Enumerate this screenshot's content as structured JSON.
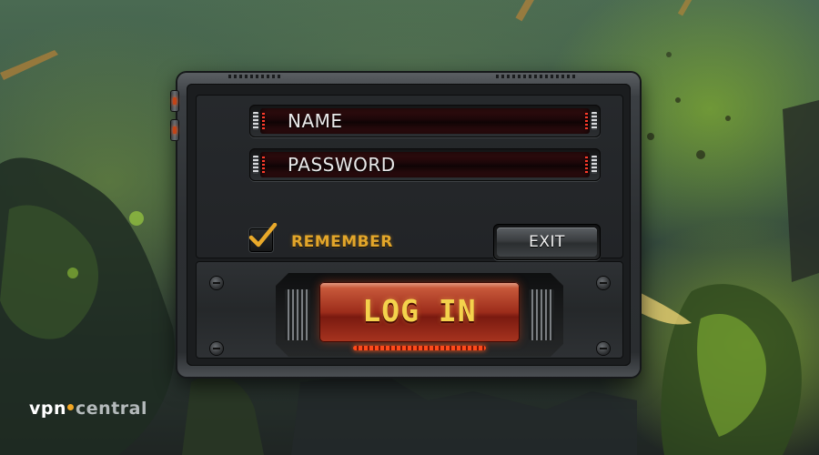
{
  "login": {
    "name_label": "NAME",
    "password_label": "PASSWORD",
    "remember_label": "REMEMBER",
    "remember_checked": true,
    "exit_label": "EXIT",
    "login_label": "LOG IN"
  },
  "watermark": {
    "part1": "vpn",
    "part2": "central"
  },
  "colors": {
    "accent_gold": "#e3a62a",
    "login_text": "#f4d24c",
    "login_button": "#9d2d1b",
    "field_well": "#1a0608"
  },
  "icons": {
    "checkmark": "checkmark-icon",
    "watermark_dot": "dot-icon"
  }
}
